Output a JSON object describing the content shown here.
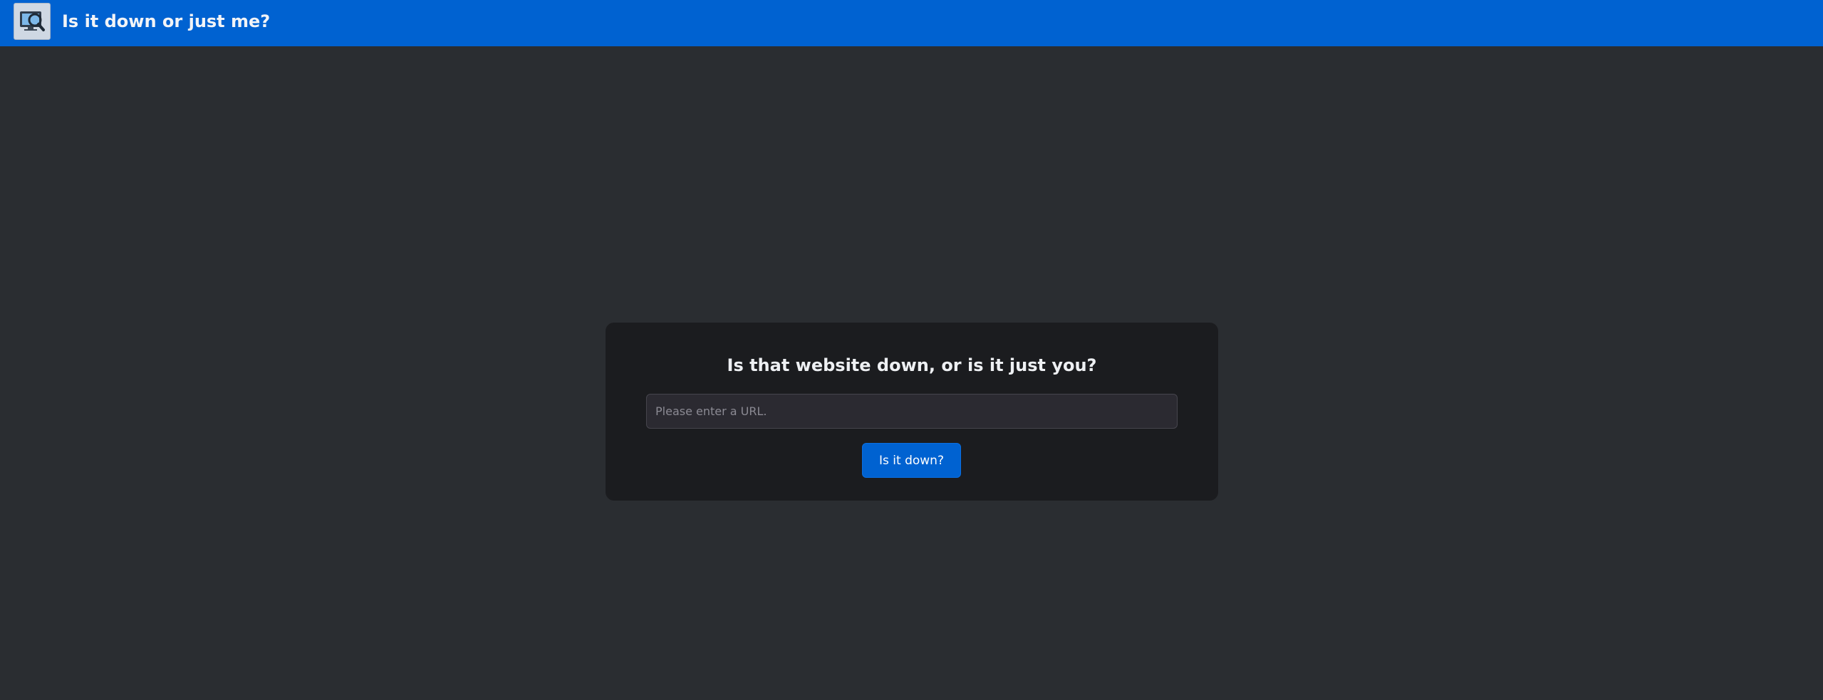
{
  "header": {
    "logo_icon": "search-monitor-icon",
    "title": "Is it down or just me?",
    "background_color": "#0062d1"
  },
  "main": {
    "background_color": "#2a2d31",
    "card": {
      "heading": "Is that website down, or is it just you?",
      "url_input": {
        "placeholder": "Please enter a URL.",
        "value": ""
      },
      "submit_label": "Is it down?",
      "background_color": "#1b1c1f"
    }
  }
}
